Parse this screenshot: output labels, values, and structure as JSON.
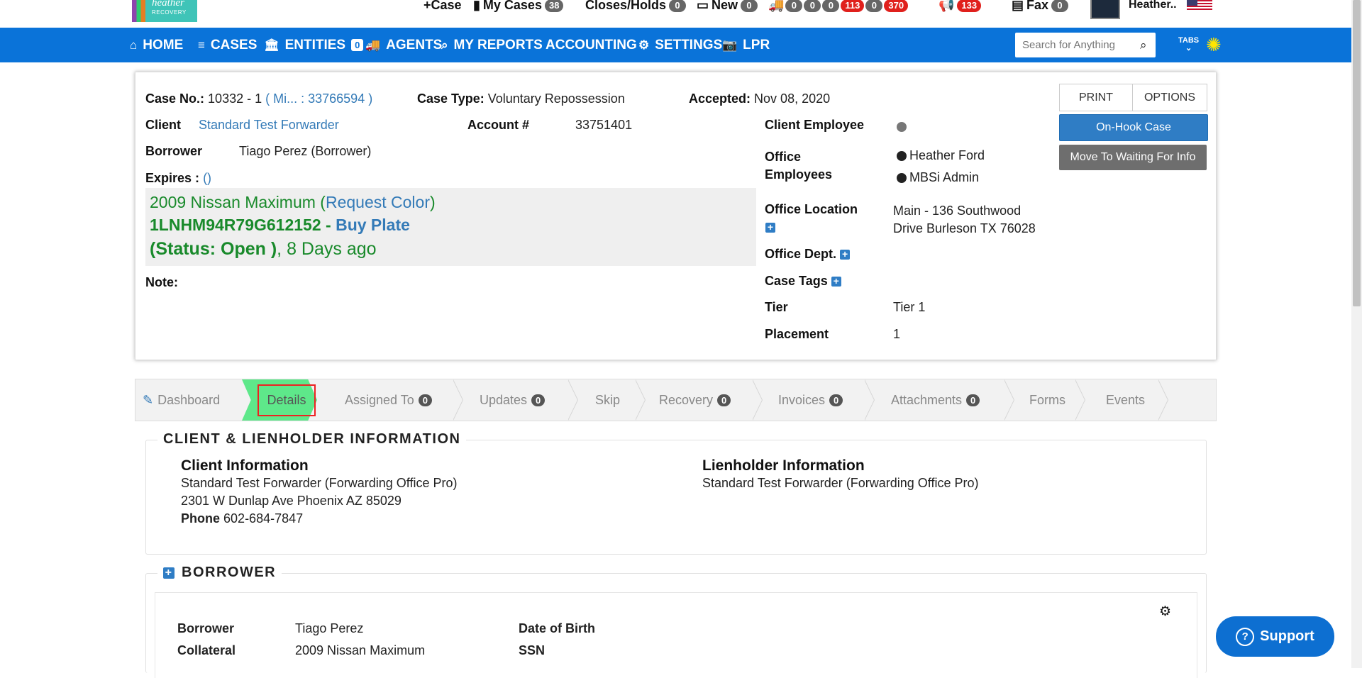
{
  "topbar": {
    "logo_text": "heather",
    "logo_sub": "RECOVERY",
    "case_label": "+Case",
    "my_cases_label": "My Cases",
    "my_cases_count": "38",
    "closes_holds_label": "Closes/Holds",
    "closes_holds_count": "0",
    "new_label": "New",
    "new_count": "0",
    "truck_counts": [
      "0",
      "0",
      "0",
      "113",
      "0",
      "370"
    ],
    "announce_count": "133",
    "fax_label": "Fax",
    "fax_count": "0",
    "user_name": "Heather.."
  },
  "nav": {
    "home": "HOME",
    "cases": "CASES",
    "entities": "ENTITIES",
    "entities_count": "0",
    "agents": "AGENTS",
    "my_reports": "MY REPORTS",
    "accounting": "ACCOUNTING",
    "settings": "SETTINGS",
    "lpr": "LPR",
    "search_placeholder": "Search for Anything",
    "tabs_label": "TABS"
  },
  "case": {
    "case_no_label": "Case No.:",
    "case_no": "10332 - 1",
    "case_link": "( Mi...   : 33766594 )",
    "case_type_label": "Case Type:",
    "case_type": "Voluntary Repossession",
    "accepted_label": "Accepted:",
    "accepted": "Nov 08, 2020",
    "client_label": "Client",
    "client": "Standard Test Forwarder",
    "account_label": "Account #",
    "account": "33751401",
    "borrower_label": "Borrower",
    "borrower": "Tiago Perez (Borrower)",
    "expires_label": "Expires :",
    "expires": "()",
    "vehicle_name": "2009 Nissan Maximum (",
    "request_color": "Request Color",
    "vehicle_close": ")",
    "vin": "1LNHM94R79G612152",
    "vin_sep": " - ",
    "buy_plate": "Buy Plate",
    "status": "(Status: Open )",
    "age": ", 8 Days ago",
    "note_label": "Note:",
    "client_employee_label": "Client Employee",
    "office_employees_label_1": "Office",
    "office_employees_label_2": "Employees",
    "office_employee_1": "Heather Ford",
    "office_employee_2": "MBSi Admin",
    "office_location_label": "Office Location",
    "office_location_1": "Main - 136 Southwood",
    "office_location_2": "Drive Burleson TX 76028",
    "office_dept_label": "Office Dept.",
    "case_tags_label": "Case Tags",
    "tier_label": "Tier",
    "tier": "Tier 1",
    "placement_label": "Placement",
    "placement": "1",
    "print": "PRINT",
    "options": "OPTIONS",
    "on_hook": "On-Hook Case",
    "move_waiting": "Move To Waiting For Info"
  },
  "tabs": {
    "dashboard": "Dashboard",
    "details": "Details",
    "assigned_to": "Assigned To",
    "assigned_to_count": "0",
    "updates": "Updates",
    "updates_count": "0",
    "skip": "Skip",
    "recovery": "Recovery",
    "recovery_count": "0",
    "invoices": "Invoices",
    "invoices_count": "0",
    "attachments": "Attachments",
    "attachments_count": "0",
    "forms": "Forms",
    "events": "Events"
  },
  "client_lien": {
    "legend": "CLIENT & LIENHOLDER INFORMATION",
    "client_heading": "Client Information",
    "client_name": "Standard Test Forwarder (Forwarding Office Pro)",
    "client_address": "2301 W Dunlap Ave Phoenix AZ 85029",
    "phone_label": "Phone",
    "phone": "602-684-7847",
    "lien_heading": "Lienholder Information",
    "lien_name": "Standard Test Forwarder (Forwarding Office Pro)"
  },
  "borrower_section": {
    "legend": "BORROWER",
    "borrower_label": "Borrower",
    "borrower": "Tiago Perez",
    "collateral_label": "Collateral",
    "collateral": "2009 Nissan Maximum",
    "dob_label": "Date of Birth",
    "ssn_label": "SSN"
  },
  "support": {
    "label": "Support"
  }
}
